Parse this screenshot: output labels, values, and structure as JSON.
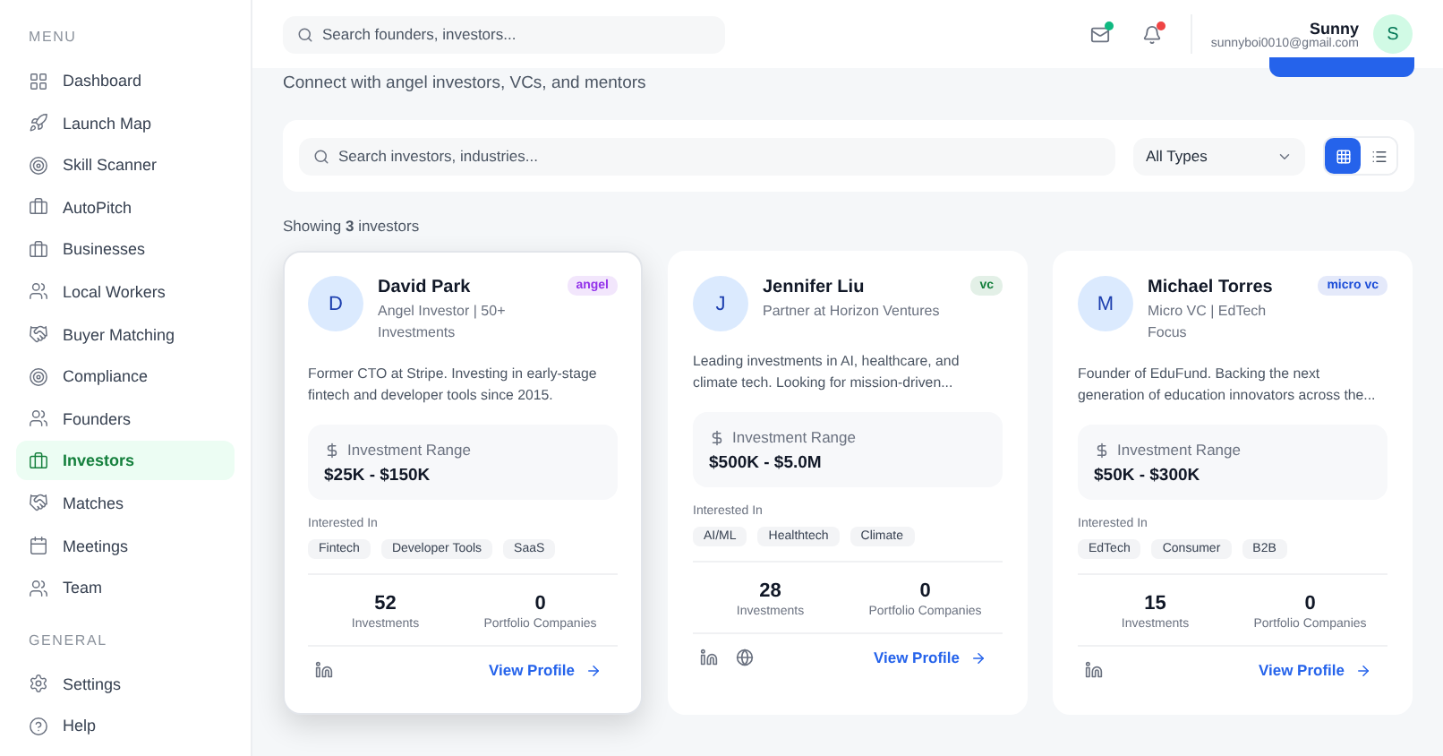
{
  "sidebar": {
    "sections": [
      {
        "title": "MENU",
        "items": [
          {
            "label": "Dashboard",
            "selected": false
          },
          {
            "label": "Launch Map",
            "selected": false
          },
          {
            "label": "Skill Scanner",
            "selected": false
          },
          {
            "label": "AutoPitch",
            "selected": false
          },
          {
            "label": "Businesses",
            "selected": false
          },
          {
            "label": "Local Workers",
            "selected": false
          },
          {
            "label": "Buyer Matching",
            "selected": false
          },
          {
            "label": "Compliance",
            "selected": false
          },
          {
            "label": "Founders",
            "selected": false
          },
          {
            "label": "Investors",
            "selected": true
          },
          {
            "label": "Matches",
            "selected": false
          },
          {
            "label": "Meetings",
            "selected": false
          },
          {
            "label": "Team",
            "selected": false
          }
        ]
      },
      {
        "title": "GENERAL",
        "items": [
          {
            "label": "Settings",
            "selected": false
          },
          {
            "label": "Help",
            "selected": false
          }
        ]
      }
    ]
  },
  "topbar": {
    "search": {
      "placeholder": "Search founders, investors..."
    },
    "mail_unread": true,
    "alerts_unread": true,
    "user": {
      "name": "Sunny",
      "email": "sunnyboi0010@gmail.com",
      "initial": "S"
    }
  },
  "subtitle": "Connect with angel investors, VCs, and mentors",
  "filters": {
    "search": {
      "placeholder": "Search investors, industries..."
    },
    "type": "All Types",
    "views": [
      {
        "kind": "grid",
        "selected": true
      },
      {
        "kind": "list",
        "selected": false
      }
    ]
  },
  "showing": "Showing **3** investors",
  "investors": [
    {
      "initial": "D",
      "name": "David Park",
      "role": "Angel Investor | 50+ Investments",
      "badge": "angel",
      "color": "#9333ea",
      "highlighted": true,
      "bio": "Former CTO at Stripe. Investing in early-stage fintech and developer tools since 2015.",
      "range_label": "Investment Range",
      "range": "$25K - $150K",
      "interests_label": "Interested In",
      "interests": [
        "Fintech",
        "Developer Tools",
        "SaaS"
      ],
      "stats": [
        {
          "value": "52",
          "label": "Investments"
        },
        {
          "value": "0",
          "label": "Portfolio Companies"
        }
      ],
      "links": [
        {
          "kind": "linkedin"
        }
      ],
      "action": "View Profile"
    },
    {
      "initial": "J",
      "name": "Jennifer Liu",
      "role": "Partner at Horizon Ventures",
      "badge": "vc",
      "color": "#15803d",
      "highlighted": false,
      "bio": "Leading investments in AI, healthcare, and climate tech. Looking for mission-driven...",
      "range_label": "Investment Range",
      "range": "$500K - $5.0M",
      "interests_label": "Interested In",
      "interests": [
        "AI/ML",
        "Healthtech",
        "Climate"
      ],
      "stats": [
        {
          "value": "28",
          "label": "Investments"
        },
        {
          "value": "0",
          "label": "Portfolio Companies"
        }
      ],
      "links": [
        {
          "kind": "linkedin"
        },
        {
          "kind": "website"
        }
      ],
      "action": "View Profile"
    },
    {
      "initial": "M",
      "name": "Michael Torres",
      "role": "Micro VC | EdTech Focus",
      "badge": "micro vc",
      "color": "#1d4ed8",
      "highlighted": false,
      "bio": "Founder of EduFund. Backing the next generation of education innovators across the...",
      "range_label": "Investment Range",
      "range": "$50K - $300K",
      "interests_label": "Interested In",
      "interests": [
        "EdTech",
        "Consumer",
        "B2B"
      ],
      "stats": [
        {
          "value": "15",
          "label": "Investments"
        },
        {
          "value": "0",
          "label": "Portfolio Companies"
        }
      ],
      "links": [
        {
          "kind": "linkedin"
        }
      ],
      "action": "View Profile"
    }
  ]
}
